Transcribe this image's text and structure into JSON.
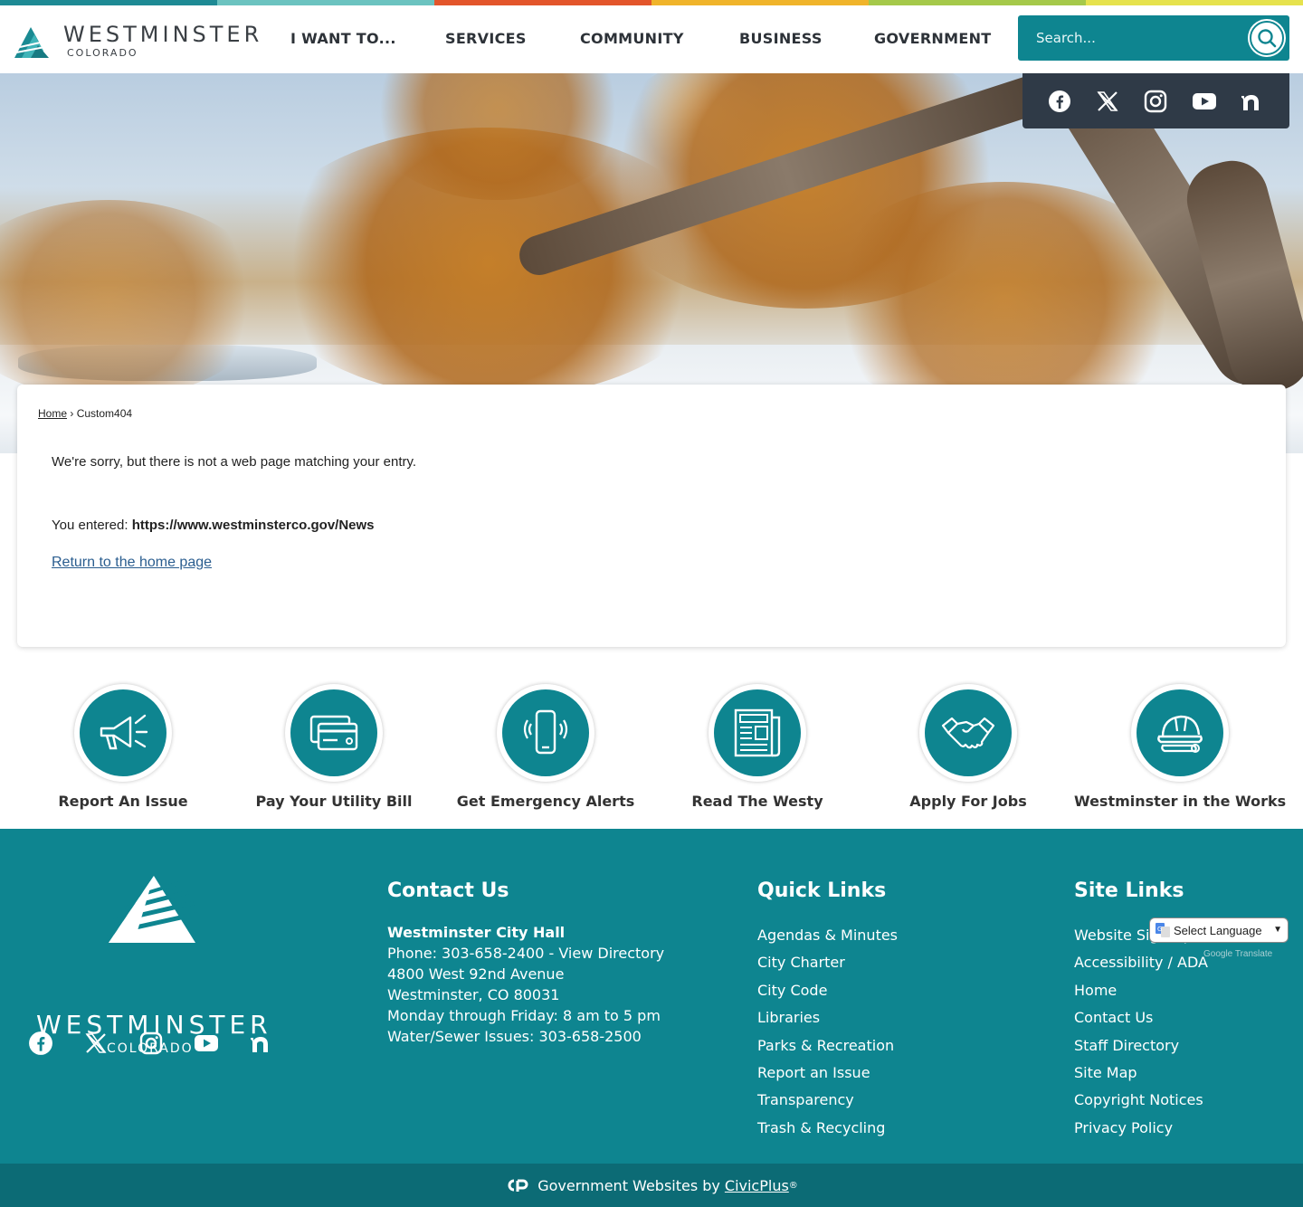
{
  "colors": {
    "teal": "#0e8590",
    "dark_teal": "#0c6b75",
    "nav_text": "#2d3238",
    "colorbar": [
      "#1e8a94",
      "#6cc3c0",
      "#e3552b",
      "#f0b42b",
      "#a5c94a",
      "#e6e24d"
    ]
  },
  "header": {
    "logo_word": "WESTMINSTER",
    "logo_sub": "COLORADO",
    "nav": [
      "I WANT TO...",
      "SERVICES",
      "COMMUNITY",
      "BUSINESS",
      "GOVERNMENT"
    ],
    "search_placeholder": "Search..."
  },
  "social_icons": [
    "facebook-icon",
    "x-icon",
    "instagram-icon",
    "youtube-icon",
    "nextdoor-icon"
  ],
  "breadcrumb": {
    "home": "Home",
    "separator": "›",
    "current": "Custom404"
  },
  "error": {
    "message": "We're sorry, but there is not a web page matching your entry.",
    "entered_label": "You entered:",
    "entered_url": "https://www.westminsterco.gov/News",
    "return_link": "Return to the home page"
  },
  "quick_links": [
    {
      "label": "Report An Issue",
      "icon": "megaphone-icon"
    },
    {
      "label": "Pay Your Utility Bill",
      "icon": "credit-card-icon"
    },
    {
      "label": "Get Emergency Alerts",
      "icon": "phone-alert-icon"
    },
    {
      "label": "Read The Westy",
      "icon": "newspaper-icon"
    },
    {
      "label": "Apply For Jobs",
      "icon": "handshake-icon"
    },
    {
      "label": "Westminster in the Works",
      "icon": "hardhat-icon"
    }
  ],
  "footer": {
    "logo_word": "WESTMINSTER",
    "logo_sub": "COLORADO",
    "contact": {
      "title": "Contact Us",
      "org": "Westminster City Hall",
      "phone": "Phone: 303-658-2400 - ",
      "directory": "View Directory",
      "address1": "4800 West 92nd Avenue",
      "address2": "Westminster, CO 80031",
      "hours": "Monday through Friday: 8 am to 5 pm",
      "water": "Water/Sewer Issues: 303-658-2500"
    },
    "quick": {
      "title": "Quick Links",
      "links": [
        "Agendas & Minutes",
        "City Charter",
        "City Code",
        "Libraries",
        "Parks & Recreation",
        "Report an Issue",
        "Transparency",
        "Trash & Recycling"
      ]
    },
    "site": {
      "title": "Site Links",
      "links": [
        "Website Sign Up",
        "Accessibility / ADA",
        "Home",
        "Contact Us",
        "Staff Directory",
        "Site Map",
        "Copyright Notices",
        "Privacy Policy"
      ]
    },
    "translate": {
      "label": "Select Language",
      "powered": "Google Translate"
    }
  },
  "bottom": {
    "text": "Government Websites by",
    "link": "CivicPlus",
    "reg": "®"
  }
}
